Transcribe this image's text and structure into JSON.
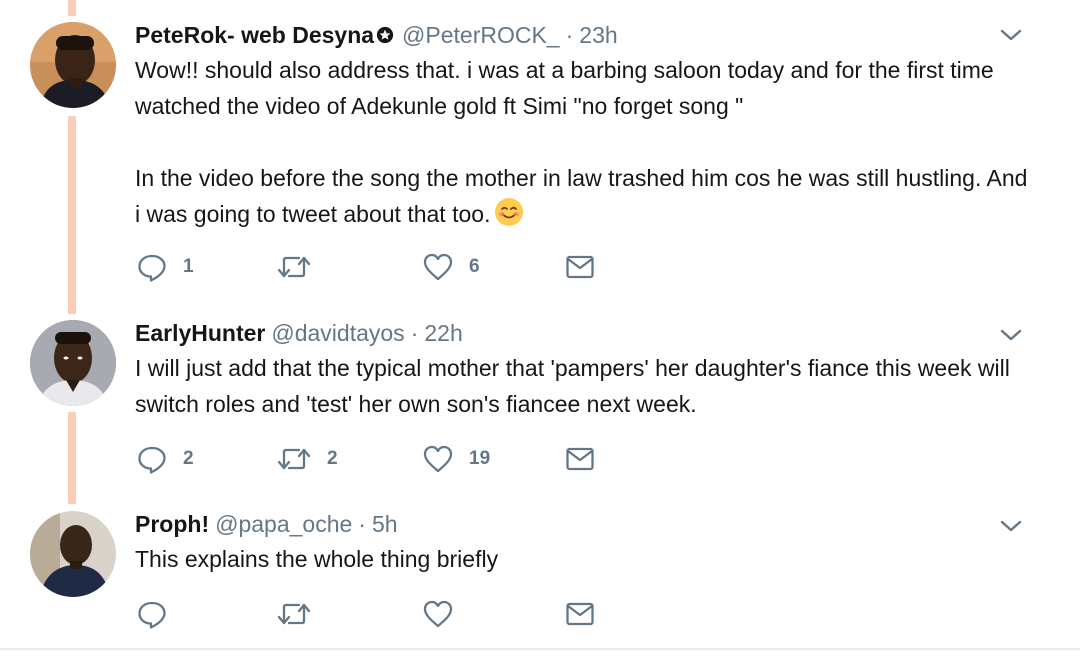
{
  "tweets": [
    {
      "display_name": "PeteRok- web Desyna",
      "badge_icon": "badge-icon",
      "handle": "@PeterROCK_",
      "separator": "·",
      "time": "23h",
      "text_lines": [
        "Wow!! should also address that. i was at a barbing saloon today and for the first time watched the video of Adekunle gold ft Simi \"no forget song \"",
        "In the video before the song the mother in law trashed him cos he was still hustling. And i was going to tweet about that too."
      ],
      "emoji": "smiling-face-emoji",
      "reply_count": "1",
      "retweet_count": "",
      "like_count": "6"
    },
    {
      "display_name": "EarlyHunter",
      "handle": "@davidtayos",
      "separator": "·",
      "time": "22h",
      "text_lines": [
        "I will just add that the typical mother that 'pampers' her daughter's fiance this week will switch roles and 'test' her own son's fiancee next week."
      ],
      "reply_count": "2",
      "retweet_count": "2",
      "like_count": "19"
    },
    {
      "display_name": "Proph!",
      "handle": "@papa_oche",
      "separator": "·",
      "time": "5h",
      "text_lines": [
        "This explains the whole thing briefly"
      ],
      "reply_count": "",
      "retweet_count": "",
      "like_count": ""
    }
  ],
  "colors": {
    "thread_line": "#f9cdb7",
    "secondary_text": "#657786",
    "primary_text": "#14171a",
    "icon_gray": "#657786"
  }
}
